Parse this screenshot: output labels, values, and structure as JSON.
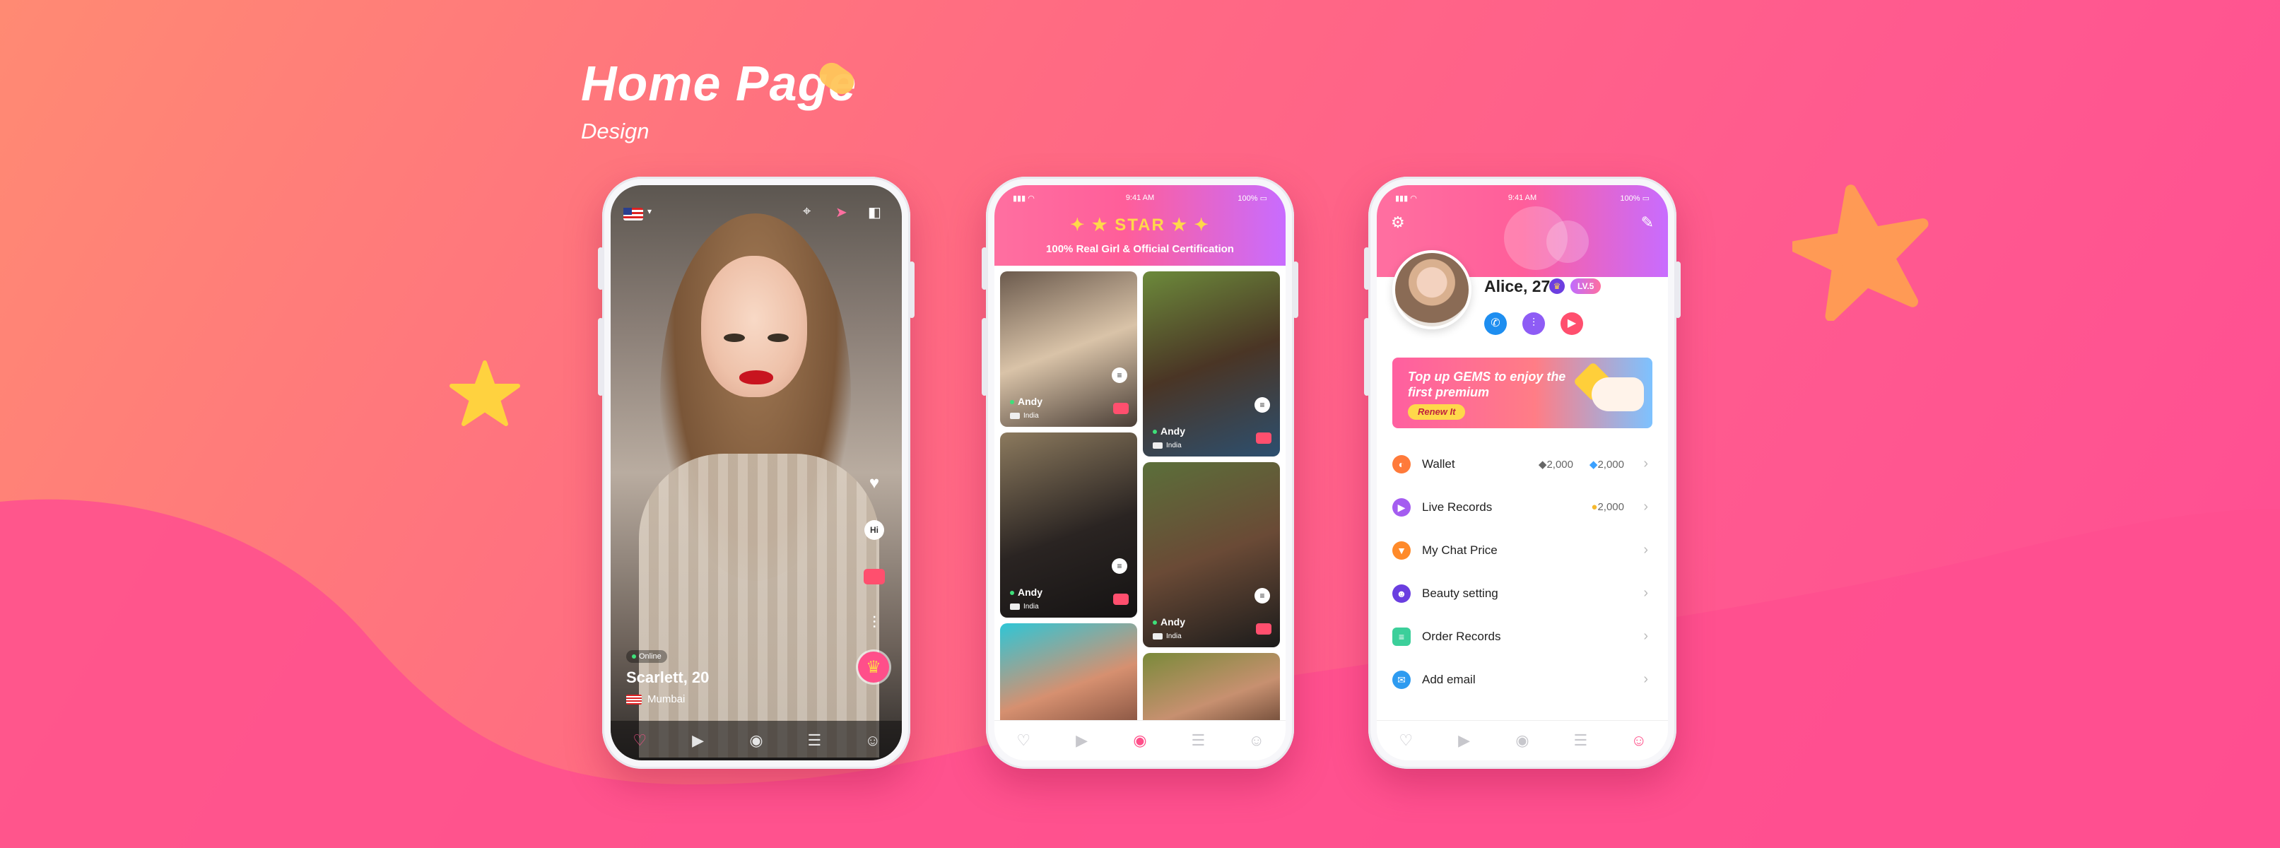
{
  "heading": {
    "title": "Home Page",
    "subtitle": "Design"
  },
  "phone1": {
    "status_label": "Online",
    "name": "Scarlett, 20",
    "city": "Mumbai",
    "hi_label": "Hi"
  },
  "phone2": {
    "status": {
      "time": "9:41 AM",
      "battery": "100%"
    },
    "brand": "STAR",
    "certification": "100% Real Girl & Official Certification",
    "cards": [
      {
        "name": "Andy",
        "country": "India"
      },
      {
        "name": "Andy",
        "country": "India"
      },
      {
        "name": "Andy",
        "country": "India"
      },
      {
        "name": "Andy",
        "country": "India"
      }
    ]
  },
  "phone3": {
    "status": {
      "time": "9:41 AM",
      "battery": "100%"
    },
    "profile_name": "Alice, 27",
    "level": "LV.5",
    "banner": {
      "text": "Top up GEMS to enjoy the first premium",
      "button": "Renew It"
    },
    "menu": [
      {
        "label": "Wallet",
        "value1": "2,000",
        "value2": "2,000"
      },
      {
        "label": "Live Records",
        "value1": "2,000"
      },
      {
        "label": "My Chat Price"
      },
      {
        "label": "Beauty setting"
      },
      {
        "label": "Order Records"
      },
      {
        "label": "Add email"
      }
    ]
  },
  "colors": {
    "accent": "#ff4f8a",
    "gold": "#ffd84a",
    "purple": "#c86cff"
  }
}
